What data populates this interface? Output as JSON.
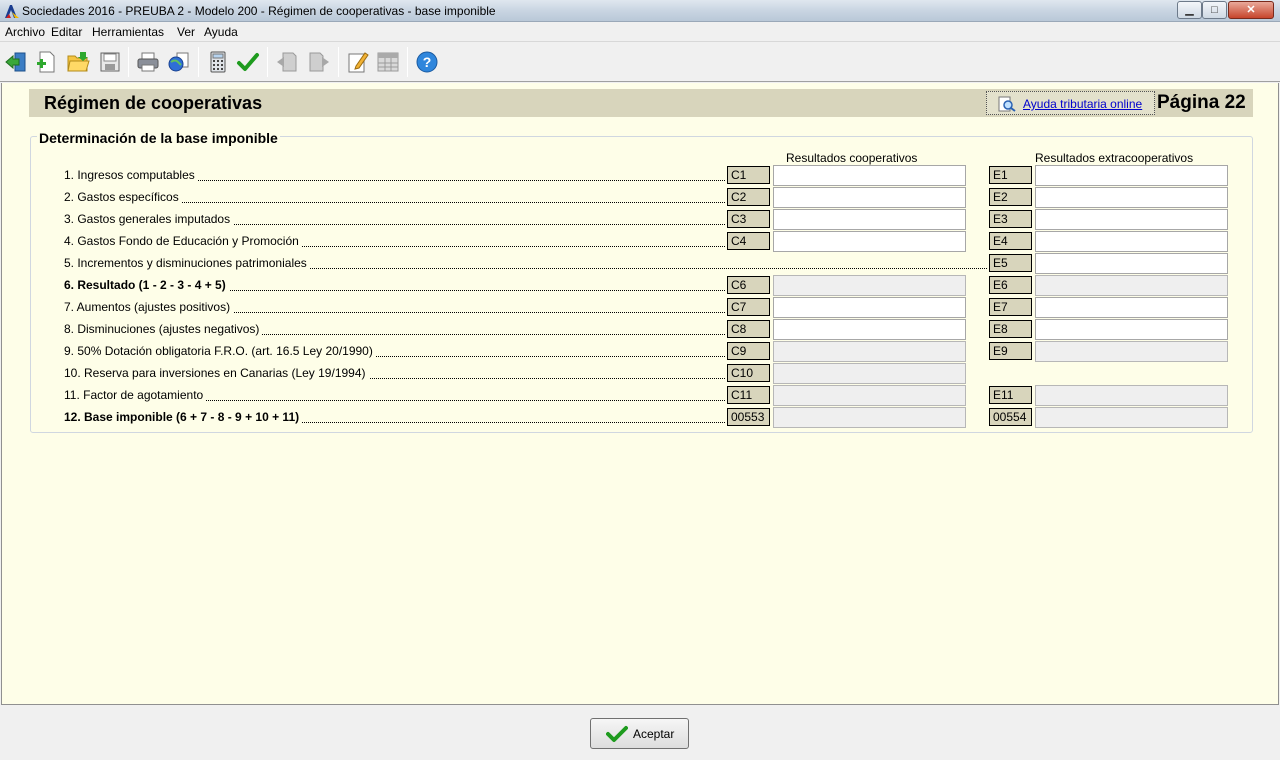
{
  "window": {
    "title": "Sociedades 2016 - PREUBA 2 - Modelo 200 - Régimen de cooperativas - base imponible",
    "minimize": "▁",
    "maximize": "□",
    "close": "✕"
  },
  "menu": [
    "Archivo",
    "Editar",
    "Herramientas",
    "Ver",
    "Ayuda"
  ],
  "toolbar": [
    "exit-icon",
    "new-document-icon",
    "open-folder-icon",
    "save-icon",
    "print-icon",
    "internet-globe-icon",
    "calculator-icon",
    "check-icon",
    "previous-page-icon",
    "next-page-icon",
    "edit-icon",
    "table-icon",
    "help-icon"
  ],
  "page": {
    "title": "Régimen de cooperativas",
    "help_link": "Ayuda tributaria online",
    "page_number": "Página 22"
  },
  "section": {
    "title": "Determinación de la base imponible",
    "col_coop": "Resultados cooperativos",
    "col_extra": "Resultados extracooperativos"
  },
  "rows": [
    {
      "label": "1. Ingresos computables",
      "bold": false,
      "coop": "C1",
      "extra": "E1",
      "coop_readonly": false,
      "extra_readonly": false
    },
    {
      "label": "2. Gastos específicos",
      "bold": false,
      "coop": "C2",
      "extra": "E2",
      "coop_readonly": false,
      "extra_readonly": false
    },
    {
      "label": "3. Gastos generales imputados",
      "bold": false,
      "coop": "C3",
      "extra": "E3",
      "coop_readonly": false,
      "extra_readonly": false
    },
    {
      "label": "4. Gastos Fondo de Educación y Promoción",
      "bold": false,
      "coop": "C4",
      "extra": "E4",
      "coop_readonly": false,
      "extra_readonly": false
    },
    {
      "label": "5. Incrementos y disminuciones patrimoniales",
      "bold": false,
      "coop": null,
      "extra": "E5",
      "coop_readonly": false,
      "extra_readonly": false
    },
    {
      "label": "6. Resultado (1 - 2 - 3 - 4 + 5)",
      "bold": true,
      "coop": "C6",
      "extra": "E6",
      "coop_readonly": true,
      "extra_readonly": true
    },
    {
      "label": "7. Aumentos (ajustes positivos)",
      "bold": false,
      "coop": "C7",
      "extra": "E7",
      "coop_readonly": false,
      "extra_readonly": false
    },
    {
      "label": "8. Disminuciones (ajustes negativos)",
      "bold": false,
      "coop": "C8",
      "extra": "E8",
      "coop_readonly": false,
      "extra_readonly": false
    },
    {
      "label": "9. 50% Dotación obligatoria F.R.O. (art. 16.5 Ley 20/1990)",
      "bold": false,
      "coop": "C9",
      "extra": "E9",
      "coop_readonly": true,
      "extra_readonly": true
    },
    {
      "label": "10. Reserva para inversiones en Canarias (Ley 19/1994)",
      "bold": false,
      "coop": "C10",
      "extra": null,
      "coop_readonly": true,
      "extra_readonly": false
    },
    {
      "label": "11. Factor de agotamiento",
      "bold": false,
      "coop": "C11",
      "extra": "E11",
      "coop_readonly": true,
      "extra_readonly": true
    },
    {
      "label": "12. Base imponible (6 + 7 - 8 - 9 + 10 + 11)",
      "bold": true,
      "coop": "00553",
      "extra": "00554",
      "coop_readonly": true,
      "extra_readonly": true
    }
  ],
  "footer": {
    "accept": "Aceptar"
  }
}
